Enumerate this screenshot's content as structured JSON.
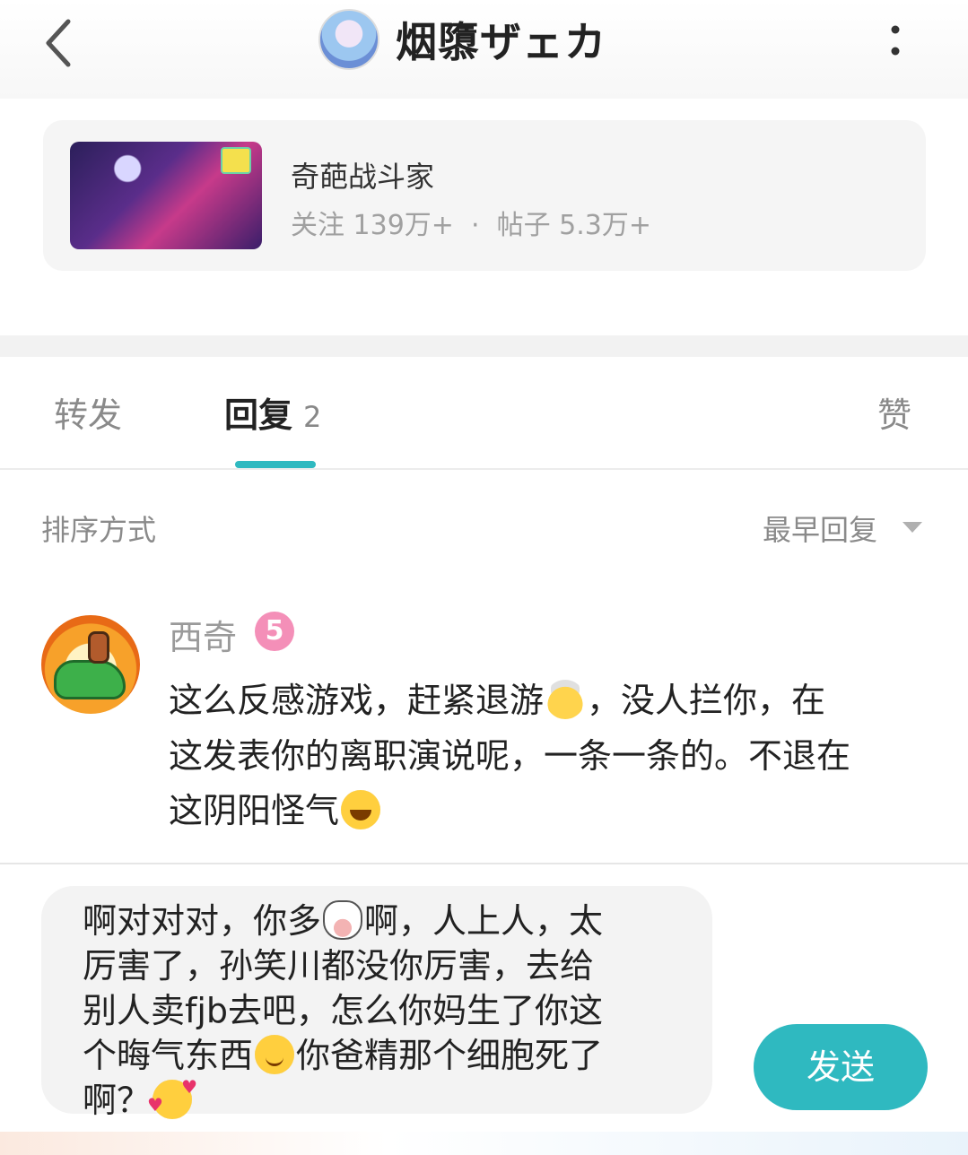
{
  "header": {
    "title": "烟隳ザェカ"
  },
  "forum": {
    "name": "奇葩战斗家",
    "stats": "关注 139万+  ·  帖子 5.3万+"
  },
  "tabs": {
    "forward": "转发",
    "reply": "回复",
    "reply_count": "2",
    "like": "赞"
  },
  "sort": {
    "label": "排序方式",
    "value": "最早回复"
  },
  "comment": {
    "author": "西奇",
    "level": "5",
    "line1_a": "这么反感游戏，赶紧退游",
    "line1_b": "，没人拦你，在",
    "line2": "这发表你的离职演说呢，一条一条的。不退在",
    "line3": "这阴阳怪气"
  },
  "input": {
    "line1_a": "啊对对对，你多",
    "line1_b": "啊，人上人，太",
    "line2": "厉害了，孙笑川都没你厉害，去给",
    "line3": "别人卖fjb去吧，怎么你妈生了你这",
    "line4_a": "个晦气东西",
    "line4_b": "你爸精那个细胞死了",
    "line5": "啊？"
  },
  "send_label": "发送",
  "colors": {
    "accent": "#2fb9c0",
    "level_badge": "#f48fb8"
  }
}
